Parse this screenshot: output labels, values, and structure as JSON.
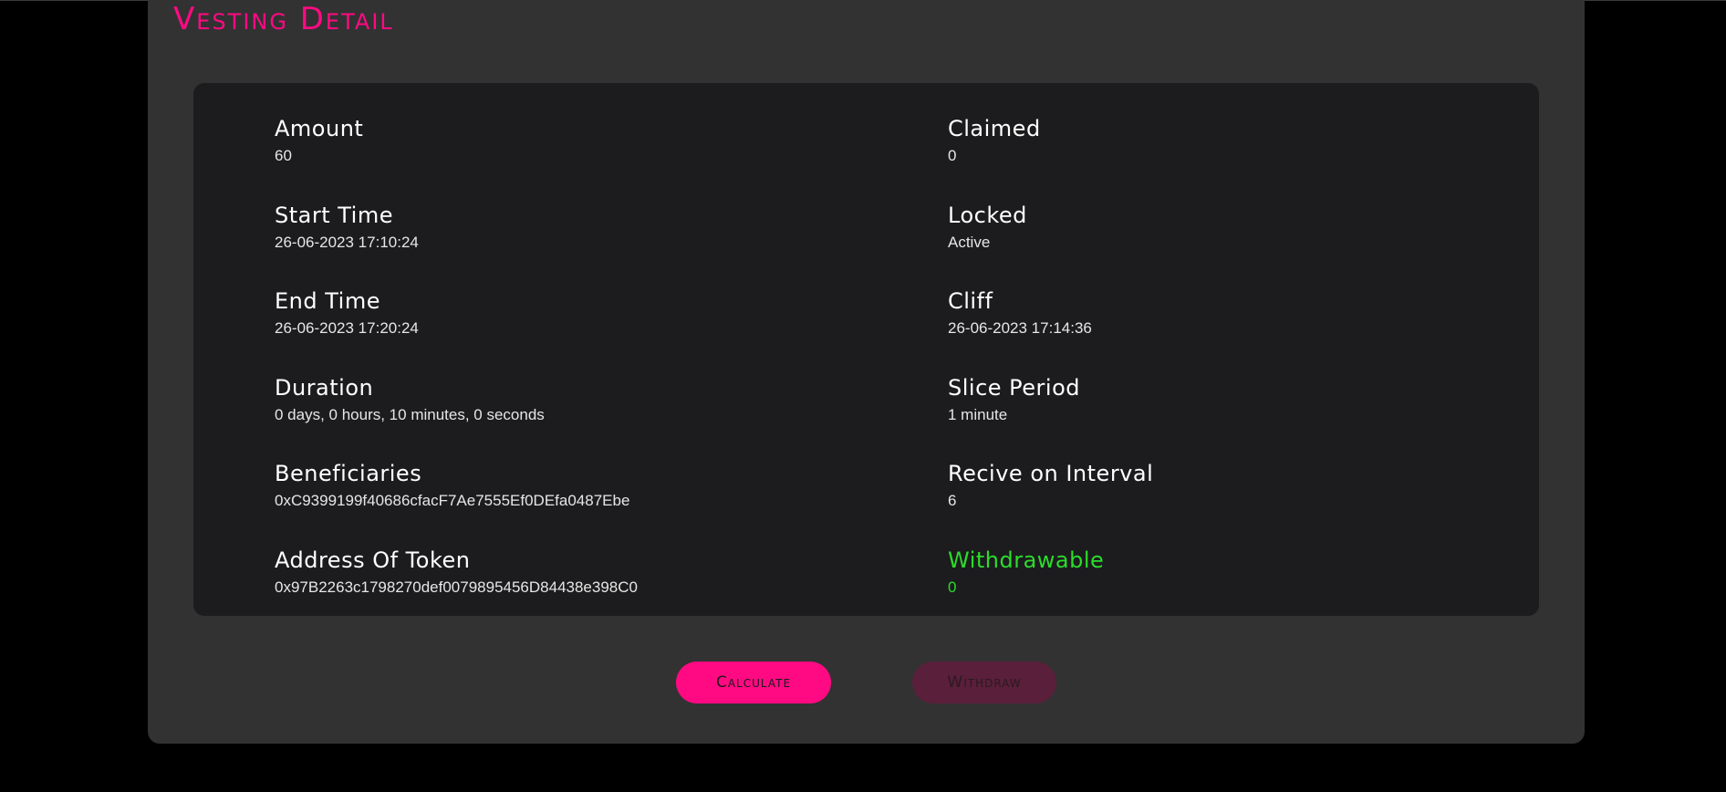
{
  "page": {
    "title": "Vesting Detail"
  },
  "details": {
    "left": [
      {
        "label": "Amount",
        "value": "60"
      },
      {
        "label": "Start Time",
        "value": "26-06-2023 17:10:24"
      },
      {
        "label": "End Time",
        "value": "26-06-2023 17:20:24"
      },
      {
        "label": "Duration",
        "value": "0 days, 0 hours, 10 minutes, 0 seconds"
      },
      {
        "label": "Beneficiaries",
        "value": "0xC9399199f40686cfacF7Ae7555Ef0DEfa0487Ebe"
      },
      {
        "label": "Address Of Token",
        "value": "0x97B2263c1798270def0079895456D84438e398C0"
      }
    ],
    "right": [
      {
        "label": "Claimed",
        "value": "0"
      },
      {
        "label": "Locked",
        "value": "Active"
      },
      {
        "label": "Cliff",
        "value": "26-06-2023 17:14:36"
      },
      {
        "label": "Slice Period",
        "value": "1 minute"
      },
      {
        "label": "Recive on Interval",
        "value": "6"
      },
      {
        "label": "Withdrawable",
        "value": "0"
      }
    ]
  },
  "actions": {
    "calculate_label": "Calculate",
    "withdraw_label": "Withdraw",
    "withdraw_enabled": false
  },
  "colors": {
    "accent": "#ff0a82",
    "withdrawable": "#2bdc2b",
    "panel": "#323232",
    "card": "#1c1c1e",
    "page_background": "#000000",
    "withdraw_disabled": "#5a1f3a"
  }
}
